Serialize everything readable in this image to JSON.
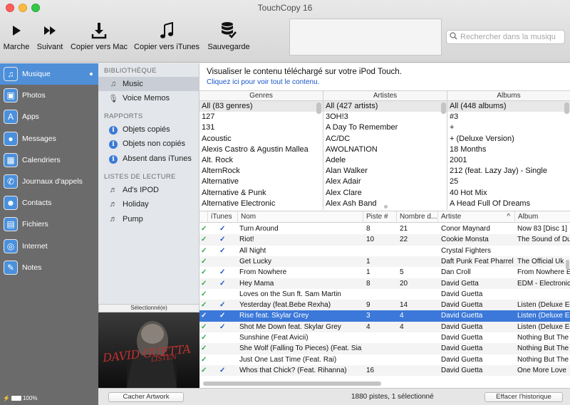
{
  "window": {
    "title": "TouchCopy 16"
  },
  "toolbar": {
    "play": "Marche",
    "next": "Suivant",
    "copy_mac": "Copier vers Mac",
    "copy_itunes": "Copier vers iTunes",
    "backup": "Sauvegarde"
  },
  "search": {
    "placeholder": "Rechercher dans la musiqu"
  },
  "nav": {
    "items": [
      {
        "label": "Musique",
        "icon": "music-note-icon"
      },
      {
        "label": "Photos",
        "icon": "photos-icon"
      },
      {
        "label": "Apps",
        "icon": "app-store-icon"
      },
      {
        "label": "Messages",
        "icon": "speech-bubble-icon"
      },
      {
        "label": "Calendriers",
        "icon": "calendar-icon"
      },
      {
        "label": "Journaux d'appels",
        "icon": "phone-icon"
      },
      {
        "label": "Contacts",
        "icon": "contacts-icon"
      },
      {
        "label": "Fichiers",
        "icon": "files-icon"
      },
      {
        "label": "Internet",
        "icon": "globe-icon"
      },
      {
        "label": "Notes",
        "icon": "pencil-icon"
      }
    ],
    "battery": "100%"
  },
  "library": {
    "section_library": "BIBLIOTHÈQUE",
    "music": "Music",
    "voice_memos": "Voice Memos",
    "section_reports": "RAPPORTS",
    "copied": "Objets copiés",
    "not_copied": "Objets non copiés",
    "absent": "Absent dans iTunes",
    "section_playlists": "LISTES DE LECTURE",
    "playlists": [
      "Ad's IPOD",
      "Holiday",
      "Pump"
    ]
  },
  "artwork": {
    "label": "Sélectionné(e)",
    "album_art_text": "DAVID GUETTA",
    "album_art_subtext": "LISTEN"
  },
  "main": {
    "description": "Visualiser le contenu téléchargé sur votre iPod Touch.",
    "link": "Cliquez ici pour voir tout le contenu."
  },
  "browser": {
    "genres": {
      "header": "Genres",
      "items": [
        "All (83 genres)",
        "127",
        "131",
        "Acoustic",
        "Alexis Castro & Agustin Mallea",
        "Alt. Rock",
        "AlternRock",
        "Alternative",
        "Alternative & Punk",
        "Alternative Electronic"
      ]
    },
    "artists": {
      "header": "Artistes",
      "items": [
        "All (427 artists)",
        "3OH!3",
        "A Day To Remember",
        "AC/DC",
        "AWOLNATION",
        "Adele",
        "Alan Walker",
        "Alex Adair",
        "Alex Clare",
        "Alex Ash Band"
      ]
    },
    "albums": {
      "header": "Albums",
      "items": [
        "All (448 albums)",
        "#3",
        "+",
        "+ (Deluxe Version)",
        "18 Months",
        "2001",
        "212 (feat. Lazy Jay) - Single",
        "25",
        "40 Hot Mix",
        "A Head Full Of Dreams"
      ]
    }
  },
  "tracks": {
    "headers": {
      "itunes": "iTunes",
      "name": "Nom",
      "track": "Piste #",
      "count": "Nombre d...",
      "artist": "Artiste",
      "album": "Album",
      "sort_arrow": "^"
    },
    "rows": [
      {
        "c1": "✓",
        "c2": "✓",
        "name": "Turn Around",
        "track": "8",
        "count": "21",
        "artist": "Conor Maynard",
        "album": "Now 83 [Disc 1]"
      },
      {
        "c1": "✓",
        "c2": "✓",
        "name": "Riot!",
        "track": "10",
        "count": "22",
        "artist": "Cookie Monsta",
        "album": "The Sound of Dubstep"
      },
      {
        "c1": "✓",
        "c2": "✓",
        "name": "All Night",
        "track": "",
        "count": "",
        "artist": "Crystal Fighters",
        "album": ""
      },
      {
        "c1": "✓",
        "c2": "",
        "name": "Get Lucky",
        "track": "1",
        "count": "",
        "artist": "Daft Punk Feat Pharrell Williams",
        "album": "The Official Uk"
      },
      {
        "c1": "✓",
        "c2": "✓",
        "name": "From Nowhere",
        "track": "1",
        "count": "5",
        "artist": "Dan Croll",
        "album": "From Nowhere EP"
      },
      {
        "c1": "✓",
        "c2": "✓",
        "name": "Hey Mama",
        "track": "8",
        "count": "20",
        "artist": "David Getta",
        "album": "EDM - Electronic"
      },
      {
        "c1": "✓",
        "c2": "",
        "name": "Loves on the Sun ft. Sam Martin",
        "track": "",
        "count": "",
        "artist": "David Guetta",
        "album": ""
      },
      {
        "c1": "✓",
        "c2": "✓",
        "name": "Yesterday (feat.Bebe Rexha)",
        "track": "9",
        "count": "14",
        "artist": "David Guetta",
        "album": "Listen (Deluxe Edition)"
      },
      {
        "c1": "✓",
        "c2": "✓",
        "name": "Rise feat. Skylar Grey",
        "track": "3",
        "count": "4",
        "artist": "David Guetta",
        "album": "Listen (Deluxe Edition)",
        "selected": true
      },
      {
        "c1": "✓",
        "c2": "✓",
        "name": "Shot Me Down feat. Skylar Grey",
        "track": "4",
        "count": "4",
        "artist": "David Guetta",
        "album": "Listen (Deluxe Edition)"
      },
      {
        "c1": "✓",
        "c2": "",
        "name": "Sunshine (Feat Avicii)",
        "track": "",
        "count": "",
        "artist": "David Guetta",
        "album": "Nothing But The Beat"
      },
      {
        "c1": "✓",
        "c2": "",
        "name": "She Wolf (Falling To Pieces) (Feat. Sia)",
        "track": "",
        "count": "",
        "artist": "David Guetta",
        "album": "Nothing But The Beat"
      },
      {
        "c1": "✓",
        "c2": "",
        "name": "Just One Last Time (Feat. Rai)",
        "track": "",
        "count": "",
        "artist": "David Guetta",
        "album": "Nothing But The Beat"
      },
      {
        "c1": "✓",
        "c2": "✓",
        "name": "Whos that Chick? (Feat. Rihanna)",
        "track": "16",
        "count": "",
        "artist": "David Guetta",
        "album": "One More Love"
      }
    ]
  },
  "bottom": {
    "hide_artwork": "Cacher Artwork",
    "status": "1880 pistes, 1 sélectionné",
    "clear_history": "Effacer l'historique"
  }
}
